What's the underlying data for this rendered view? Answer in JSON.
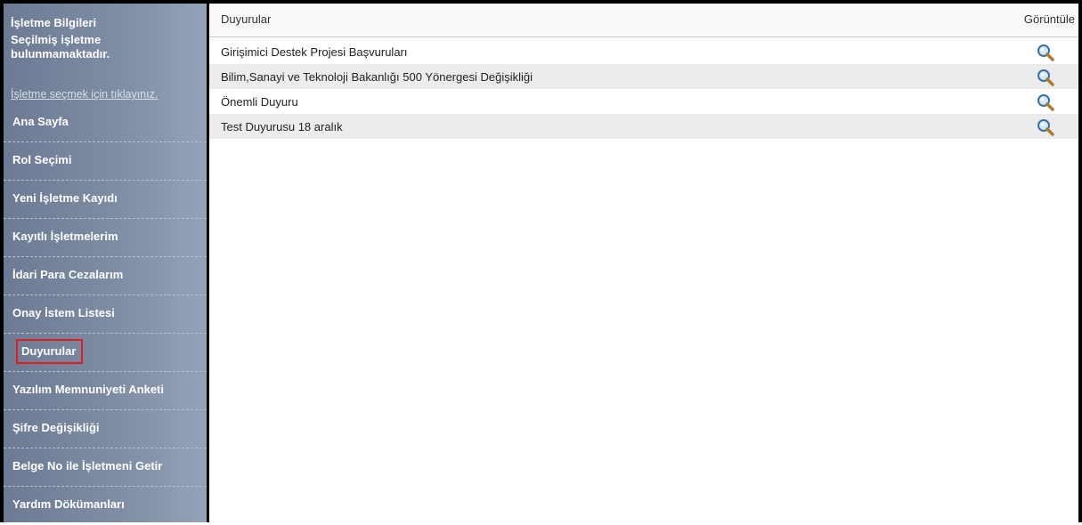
{
  "sidebar": {
    "info_title": "İşletme Bilgileri",
    "info_text": "Seçilmiş işletme bulunmamaktadır.",
    "select_link": "İşletme seçmek için tıklayınız.",
    "items": [
      {
        "label": "Ana Sayfa"
      },
      {
        "label": "Rol Seçimi"
      },
      {
        "label": "Yeni İşletme Kayıdı"
      },
      {
        "label": "Kayıtlı İşletmelerim"
      },
      {
        "label": "İdari Para Cezalarım"
      },
      {
        "label": "Onay İstem Listesi"
      },
      {
        "label": "Duyurular"
      },
      {
        "label": "Yazılım Memnuniyeti Anketi"
      },
      {
        "label": "Şifre Değişikliği"
      },
      {
        "label": "Belge No ile İşletmeni Getir"
      },
      {
        "label": "Yardım Dökümanları"
      }
    ],
    "active_item": "Duyurular"
  },
  "table": {
    "columns": [
      "Duyurular",
      "Görüntüle"
    ],
    "rows": [
      {
        "title": "Girişimici Destek Projesi Başvuruları",
        "action_icon": "magnifier-icon"
      },
      {
        "title": "Bilim,Sanayi ve Teknoloji Bakanlığı 500 Yönergesi Değişikliği",
        "action_icon": "magnifier-icon"
      },
      {
        "title": "Önemli Duyuru",
        "action_icon": "magnifier-icon"
      },
      {
        "title": "Test Duyurusu 18 aralık",
        "action_icon": "magnifier-icon"
      }
    ]
  },
  "colors": {
    "sidebar_bg": "#7e8ca4",
    "active_highlight": "#e21b1b",
    "row_alt": "#ececec"
  }
}
